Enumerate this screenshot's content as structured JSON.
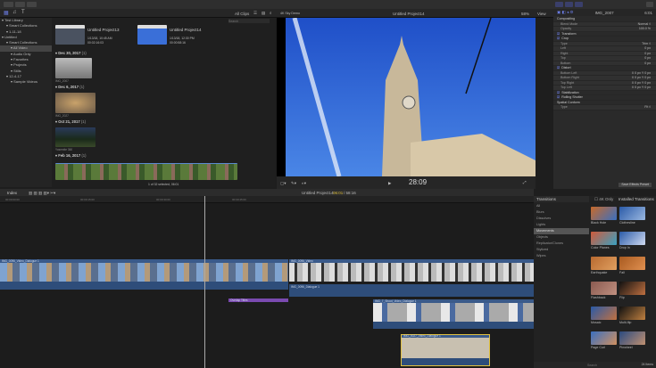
{
  "toolbar": {
    "all_clips": "All Clips",
    "search_placeholder": "Search",
    "viewer_library": "4K Sky Demo",
    "viewer_project": "Untitled Project14",
    "zoom": "58%",
    "view": "View"
  },
  "sidebar": {
    "items": [
      {
        "label": "Test Library",
        "indent": 0
      },
      {
        "label": "Smart Collections",
        "indent": 1
      },
      {
        "label": "1-11-18",
        "indent": 1
      },
      {
        "label": "Untitled",
        "indent": 0
      },
      {
        "label": "Smart Collections",
        "indent": 1
      },
      {
        "label": "All Video",
        "indent": 2,
        "selected": true
      },
      {
        "label": "Audio Only",
        "indent": 2
      },
      {
        "label": "Favorites",
        "indent": 2
      },
      {
        "label": "Projects",
        "indent": 2
      },
      {
        "label": "Stills",
        "indent": 2
      },
      {
        "label": "12-4-17",
        "indent": 1
      },
      {
        "label": "Sample Videos",
        "indent": 2
      }
    ]
  },
  "browser": {
    "projects": [
      {
        "name": "Untitled Project13",
        "date": "1/13/18, 10:45 AM",
        "duration": "00:02:16:03"
      },
      {
        "name": "Untitled Project14",
        "date": "1/13/18, 12:30 PM",
        "duration": "00:00:58:16"
      }
    ],
    "groups": [
      {
        "date": "Dec 30, 2017",
        "count": "(1)",
        "clip": "IMG_2007"
      },
      {
        "date": "Dec 6, 2017",
        "count": "(1)",
        "clip": "IMG_2027"
      },
      {
        "date": "Oct 21, 2017",
        "count": "(1)",
        "clip": "Yosemite 360"
      },
      {
        "date": "Feb 16, 2017",
        "count": "(1)",
        "clip": ""
      }
    ],
    "status": "1 of 32 selected, 06:01"
  },
  "viewer": {
    "timecode": "28:09"
  },
  "inspector": {
    "clip": "IMG_2007",
    "duration": "6:01",
    "rows": [
      {
        "label": "Compositing",
        "h": true
      },
      {
        "label": "Blend Mode",
        "v": "Normal ◊"
      },
      {
        "label": "Opacity",
        "v": "100.0 %"
      },
      {
        "label": "Transform",
        "h": true,
        "check": true
      },
      {
        "label": "Crop",
        "h": true,
        "check": true
      },
      {
        "label": "Type",
        "v": "Trim ◊"
      },
      {
        "label": "Left",
        "v": "0 px"
      },
      {
        "label": "Right",
        "v": "0 px"
      },
      {
        "label": "Top",
        "v": "0 px"
      },
      {
        "label": "Bottom",
        "v": "0 px"
      },
      {
        "label": "Distort",
        "h": true,
        "check": true
      },
      {
        "label": "Bottom Left",
        "v": "X  0 px   Y  0 px"
      },
      {
        "label": "Bottom Right",
        "v": "X  0 px   Y  0 px"
      },
      {
        "label": "Top Right",
        "v": "X  0 px   Y  0 px"
      },
      {
        "label": "Top Left",
        "v": "X  0 px   Y  0 px"
      },
      {
        "label": "Stabilization",
        "h": true,
        "check": true
      },
      {
        "label": "Rolling Shutter",
        "h": true,
        "check": true
      },
      {
        "label": "Spatial Conform",
        "h": true
      },
      {
        "label": "Type",
        "v": "Fit ◊"
      }
    ],
    "save_preset": "Save Effects Preset"
  },
  "timeline": {
    "index": "Index",
    "project": "Untitled Project14",
    "position": "06:01",
    "total": "/ 58:16",
    "ruler": [
      "00:00:00:00",
      "00:00:15:00",
      "00:00:30:00",
      "00:00:45:00"
    ],
    "clips": [
      "IMG_0096_Video_Dialogue 1",
      "IMG_0096_Video",
      "IMG_0096_Dialogue 1",
      "Overlap Titles",
      "IMG_7_Shoot_Video_Dialogue 1",
      "IMG_0027_Video_Dialogue 1"
    ]
  },
  "transitions": {
    "header": "Transitions",
    "filter": "4K Only",
    "title": "Installed Transitions",
    "categories": [
      "All",
      "Blurs",
      "Dissolves",
      "Lights",
      "Movements",
      "Objects",
      "Replicator/Clones",
      "Stylized",
      "Wipes"
    ],
    "selected": "Movements",
    "items": [
      {
        "name": "Black Hole",
        "colors": [
          "#c86a2a",
          "#3a6fc0"
        ]
      },
      {
        "name": "Clothesline",
        "colors": [
          "#2a5aa8",
          "#9ab8e0"
        ]
      },
      {
        "name": "Color Planes",
        "colors": [
          "#d05a3a",
          "#3aa0c0"
        ]
      },
      {
        "name": "Drop In",
        "colors": [
          "#2a5aa8",
          "#cfdaf0"
        ]
      },
      {
        "name": "Earthquake",
        "colors": [
          "#b86a30",
          "#e0a060"
        ]
      },
      {
        "name": "Fall",
        "colors": [
          "#a85a20",
          "#e09050"
        ]
      },
      {
        "name": "Flashback",
        "colors": [
          "#8a5a50",
          "#c09080"
        ]
      },
      {
        "name": "Flip",
        "colors": [
          "#111",
          "#c07040"
        ]
      },
      {
        "name": "Mosaic",
        "colors": [
          "#2a5aa8",
          "#c07040"
        ]
      },
      {
        "name": "Multi-flip",
        "colors": [
          "#111",
          "#c08040"
        ]
      },
      {
        "name": "Page Curl",
        "colors": [
          "#3a6fc0",
          "#d09060"
        ]
      },
      {
        "name": "Pinwheel",
        "colors": [
          "#2a4a80",
          "#c09070"
        ]
      }
    ],
    "search_placeholder": "Search",
    "count": "24 Items"
  }
}
